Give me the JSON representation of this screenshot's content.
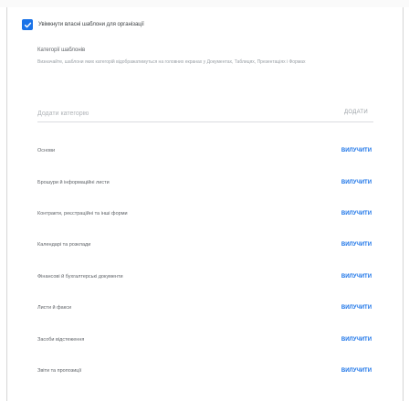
{
  "settings": {
    "enable_label": "Увімкнути власні шаблони для організації"
  },
  "categories_section": {
    "title": "Категорії шаблонів",
    "description": "Визначайте, шаблони яких категорій відображатимуться на головних екранах у Документах, Таблицях, Презентаціях і Формах"
  },
  "add_category": {
    "placeholder": "Додати категорію",
    "button_label": "ДОДАТИ"
  },
  "categories": [
    {
      "name": "Основи",
      "action": "ВИЛУЧИТИ"
    },
    {
      "name": "Брошури й інформаційні листи",
      "action": "ВИЛУЧИТИ"
    },
    {
      "name": "Контракти, реєстраційні та інші форми",
      "action": "ВИЛУЧИТИ"
    },
    {
      "name": "Календарі та розклади",
      "action": "ВИЛУЧИТИ"
    },
    {
      "name": "Фінансові й бухгалтерські документи",
      "action": "ВИЛУЧИТИ"
    },
    {
      "name": "Листи й факси",
      "action": "ВИЛУЧИТИ"
    },
    {
      "name": "Засоби відстеження",
      "action": "ВИЛУЧИТИ"
    },
    {
      "name": "Звіти та пропозиції",
      "action": "ВИЛУЧИТИ"
    }
  ],
  "colors": {
    "accent": "#1a73e8",
    "text": "#3c4043",
    "muted": "#9aa0a6"
  },
  "icons": {
    "checkbox": "checkmark-icon"
  }
}
